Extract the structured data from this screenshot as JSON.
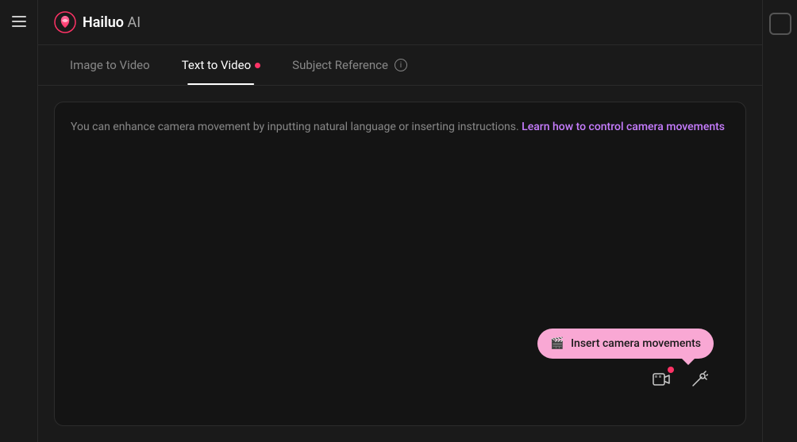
{
  "app": {
    "name": "Hailuo",
    "name_suffix": " AI"
  },
  "header": {
    "hamburger_label": "menu"
  },
  "nav": {
    "tabs": [
      {
        "id": "image-to-video",
        "label": "Image to Video",
        "active": false,
        "has_dot": false,
        "has_info": false
      },
      {
        "id": "text-to-video",
        "label": "Text to Video",
        "active": true,
        "has_dot": true,
        "has_info": false
      },
      {
        "id": "subject-reference",
        "label": "Subject Reference",
        "active": false,
        "has_dot": false,
        "has_info": true
      }
    ]
  },
  "content": {
    "hint_text_start": "You can enhance camera movement by inputting natural language or inserting instructions. ",
    "hint_link_text": "Learn how to control camera movements",
    "hint_link_url": "#"
  },
  "tooltip": {
    "label": "Insert camera movements",
    "camera_icon": "🎬"
  },
  "toolbar": {
    "video_icon_label": "insert-video",
    "edit_icon_label": "edit"
  },
  "right_panel": {
    "toggle_label": "panel-toggle"
  },
  "colors": {
    "accent_pink": "#ff3366",
    "tooltip_bg": "#f9a8d4",
    "active_tab_color": "#ffffff",
    "inactive_tab_color": "#888888",
    "link_color": "#c77dff",
    "bg_primary": "#1a1a1a",
    "bg_input": "#141414",
    "border_color": "#2d2d2d"
  }
}
